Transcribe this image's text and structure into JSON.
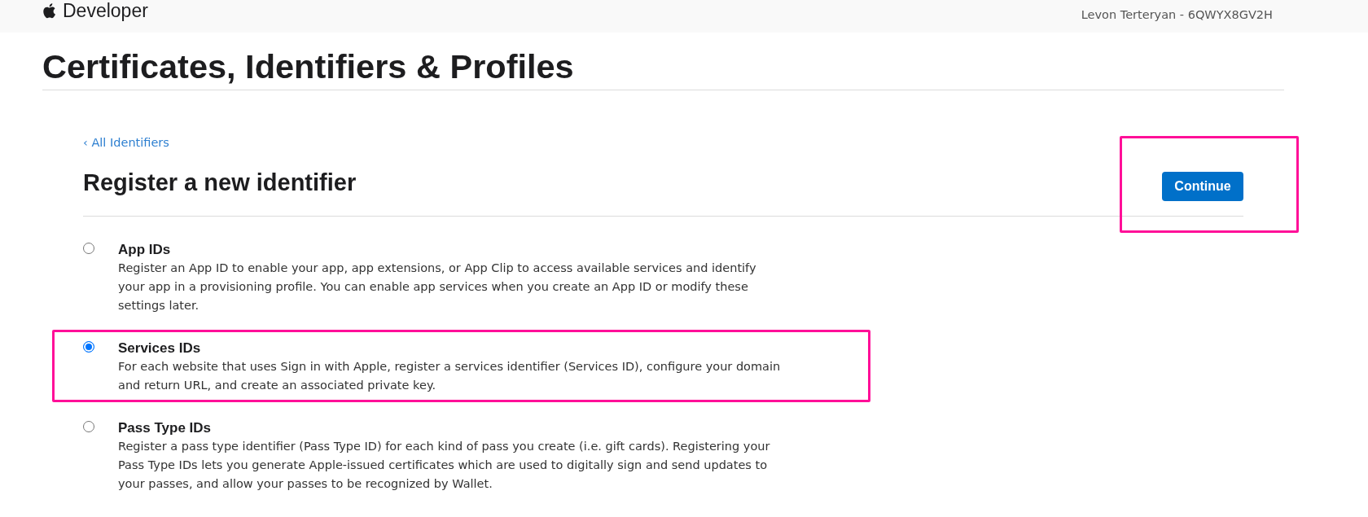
{
  "top_bar": {
    "brand": "Developer",
    "account": "Levon Terteryan - 6QWYX8GV2H"
  },
  "page_title": "Certificates, Identifiers & Profiles",
  "back_link": {
    "label": "‹ All Identifiers"
  },
  "section": {
    "title": "Register a new identifier",
    "continue_button": {
      "label": "Continue",
      "highlighted": true
    }
  },
  "options": [
    {
      "title": "App IDs",
      "description": "Register an App ID to enable your app, app extensions, or App Clip to access available services and identify your app in a provisioning profile. You can enable app services when you create an App ID or modify these settings later.",
      "selected": false,
      "highlighted": false
    },
    {
      "title": "Services IDs",
      "description": "For each website that uses Sign in with Apple, register a services identifier (Services ID), configure your domain and return URL, and create an associated private key.",
      "selected": true,
      "highlighted": true
    },
    {
      "title": "Pass Type IDs",
      "description": "Register a pass type identifier (Pass Type ID) for each kind of pass you create (i.e. gift cards). Registering your Pass Type IDs lets you generate Apple-issued certificates which are used to digitally sign and send updates to your passes, and allow your passes to be recognized by Wallet.",
      "selected": false,
      "highlighted": false
    }
  ]
}
